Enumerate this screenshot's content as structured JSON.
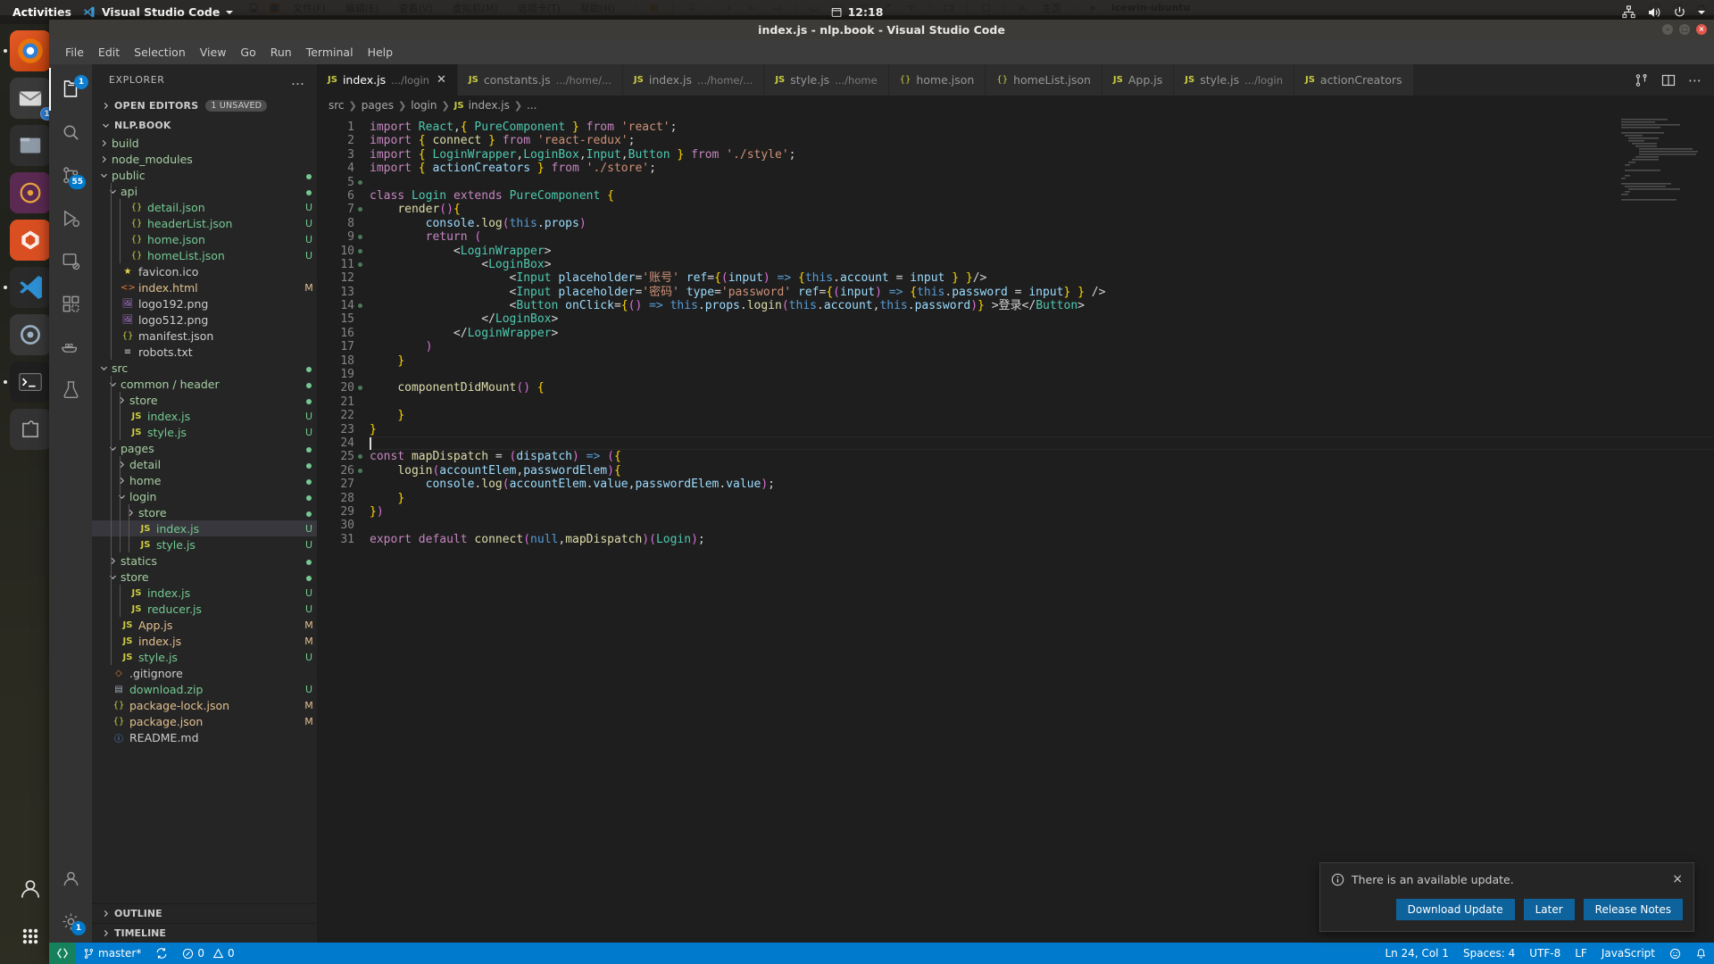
{
  "host": {
    "gnome": {
      "activities": "Activities",
      "app_name": "Visual Studio Code",
      "clock": "12:18",
      "app_icon": "vscode-icon",
      "network_icon": "network-icon",
      "volume_icon": "volume-icon",
      "power_icon": "power-icon"
    },
    "virtualbox": {
      "menus": [
        "文件(F)",
        "编辑(E)",
        "查看(V)",
        "虚拟机(M)",
        "选项卡(T)",
        "帮助(H)"
      ],
      "vm_name": "icewin-ubuntu",
      "indicator": "主页"
    }
  },
  "window": {
    "title": "index.js - nlp.book - Visual Studio Code",
    "minimize": "–",
    "maximize": "□",
    "close": "×"
  },
  "menubar": [
    "File",
    "Edit",
    "Selection",
    "View",
    "Go",
    "Run",
    "Terminal",
    "Help"
  ],
  "activitybar": {
    "items": [
      {
        "name": "explorer-icon",
        "badge": ""
      },
      {
        "name": "search-icon",
        "badge": ""
      },
      {
        "name": "source-control-icon",
        "badge": "55"
      },
      {
        "name": "run-debug-icon",
        "badge": ""
      },
      {
        "name": "remote-explorer-icon",
        "badge": ""
      },
      {
        "name": "extensions-icon",
        "badge": ""
      },
      {
        "name": "docker-icon",
        "badge": ""
      },
      {
        "name": "test-icon",
        "badge": ""
      }
    ],
    "bottom": [
      {
        "name": "accounts-icon",
        "badge": ""
      },
      {
        "name": "settings-gear-icon",
        "badge": "1"
      }
    ]
  },
  "sidebar": {
    "title": "EXPLORER",
    "more_actions": "…",
    "open_editors": {
      "label": "OPEN EDITORS",
      "badge": "1 UNSAVED",
      "expanded": false
    },
    "project": {
      "label": "NLP.BOOK",
      "expanded": true,
      "status": ""
    },
    "outline": "OUTLINE",
    "timeline": "TIMELINE",
    "tree": [
      {
        "label": "build",
        "depth": 1,
        "kind": "folder",
        "expanded": false,
        "status": ""
      },
      {
        "label": "node_modules",
        "depth": 1,
        "kind": "folder",
        "expanded": false,
        "status": ""
      },
      {
        "label": "public",
        "depth": 1,
        "kind": "folder",
        "expanded": true,
        "status": "dot"
      },
      {
        "label": "api",
        "depth": 2,
        "kind": "folder",
        "expanded": true,
        "status": "dot"
      },
      {
        "label": "detail.json",
        "depth": 3,
        "kind": "json",
        "status": "U"
      },
      {
        "label": "headerList.json",
        "depth": 3,
        "kind": "json",
        "status": "U"
      },
      {
        "label": "home.json",
        "depth": 3,
        "kind": "json",
        "status": "U"
      },
      {
        "label": "homeList.json",
        "depth": 3,
        "kind": "json",
        "status": "U"
      },
      {
        "label": "favicon.ico",
        "depth": 2,
        "kind": "star",
        "status": ""
      },
      {
        "label": "index.html",
        "depth": 2,
        "kind": "html",
        "status": "M"
      },
      {
        "label": "logo192.png",
        "depth": 2,
        "kind": "image",
        "status": ""
      },
      {
        "label": "logo512.png",
        "depth": 2,
        "kind": "image",
        "status": ""
      },
      {
        "label": "manifest.json",
        "depth": 2,
        "kind": "json",
        "status": ""
      },
      {
        "label": "robots.txt",
        "depth": 2,
        "kind": "txt",
        "status": ""
      },
      {
        "label": "src",
        "depth": 1,
        "kind": "folder",
        "expanded": true,
        "status": "dot"
      },
      {
        "label": "common / header",
        "depth": 2,
        "kind": "folder",
        "expanded": true,
        "status": "dot"
      },
      {
        "label": "store",
        "depth": 3,
        "kind": "folder",
        "expanded": false,
        "status": "dot"
      },
      {
        "label": "index.js",
        "depth": 3,
        "kind": "js",
        "status": "U"
      },
      {
        "label": "style.js",
        "depth": 3,
        "kind": "js",
        "status": "U"
      },
      {
        "label": "pages",
        "depth": 2,
        "kind": "folder",
        "expanded": true,
        "status": "dot"
      },
      {
        "label": "detail",
        "depth": 3,
        "kind": "folder",
        "expanded": false,
        "status": "dot"
      },
      {
        "label": "home",
        "depth": 3,
        "kind": "folder",
        "expanded": false,
        "status": "dot"
      },
      {
        "label": "login",
        "depth": 3,
        "kind": "folder",
        "expanded": true,
        "status": "dot"
      },
      {
        "label": "store",
        "depth": 4,
        "kind": "folder",
        "expanded": false,
        "status": "dot"
      },
      {
        "label": "index.js",
        "depth": 4,
        "kind": "js",
        "status": "U",
        "selected": true
      },
      {
        "label": "style.js",
        "depth": 4,
        "kind": "js",
        "status": "U"
      },
      {
        "label": "statics",
        "depth": 2,
        "kind": "folder",
        "expanded": false,
        "status": "dot"
      },
      {
        "label": "store",
        "depth": 2,
        "kind": "folder",
        "expanded": true,
        "status": "dot"
      },
      {
        "label": "index.js",
        "depth": 3,
        "kind": "js",
        "status": "U"
      },
      {
        "label": "reducer.js",
        "depth": 3,
        "kind": "js",
        "status": "U"
      },
      {
        "label": "App.js",
        "depth": 2,
        "kind": "js",
        "status": "M"
      },
      {
        "label": "index.js",
        "depth": 2,
        "kind": "js",
        "status": "M"
      },
      {
        "label": "style.js",
        "depth": 2,
        "kind": "js",
        "status": "U"
      },
      {
        "label": ".gitignore",
        "depth": 1,
        "kind": "git",
        "status": ""
      },
      {
        "label": "download.zip",
        "depth": 1,
        "kind": "zip",
        "status": "U"
      },
      {
        "label": "package-lock.json",
        "depth": 1,
        "kind": "json",
        "status": "M"
      },
      {
        "label": "package.json",
        "depth": 1,
        "kind": "json",
        "status": "M"
      },
      {
        "label": "README.md",
        "depth": 1,
        "kind": "md",
        "status": ""
      }
    ]
  },
  "editor": {
    "tabs": [
      {
        "name": "index.js",
        "path": ".../login",
        "kind": "js",
        "active": true,
        "dirty": false
      },
      {
        "name": "constants.js",
        "path": ".../home/...",
        "kind": "js",
        "active": false
      },
      {
        "name": "index.js",
        "path": ".../home/...",
        "kind": "js",
        "active": false
      },
      {
        "name": "style.js",
        "path": ".../home",
        "kind": "js",
        "active": false
      },
      {
        "name": "home.json",
        "path": "",
        "kind": "json",
        "active": false
      },
      {
        "name": "homeList.json",
        "path": "",
        "kind": "json",
        "active": false
      },
      {
        "name": "App.js",
        "path": "",
        "kind": "js",
        "active": false
      },
      {
        "name": "style.js",
        "path": ".../login",
        "kind": "js",
        "active": false
      },
      {
        "name": "actionCreators",
        "path": "",
        "kind": "js",
        "active": false
      }
    ],
    "tab_actions": [
      {
        "name": "split-editor-down-icon",
        "label": "⑂"
      },
      {
        "name": "split-editor-icon",
        "label": "▥"
      },
      {
        "name": "more-actions-icon",
        "label": "…"
      }
    ],
    "breadcrumb": [
      "src",
      "pages",
      "login",
      "index.js",
      "..."
    ],
    "breadcrumb_file_icon": "JS",
    "line_numbers": [
      1,
      2,
      3,
      4,
      5,
      6,
      7,
      8,
      9,
      10,
      11,
      12,
      13,
      14,
      15,
      16,
      17,
      18,
      19,
      20,
      21,
      22,
      23,
      24,
      25,
      26,
      27,
      28,
      29,
      30,
      31
    ],
    "lines": [
      "import React,{ PureComponent } from 'react';",
      "import { connect } from 'react-redux';",
      "import { LoginWrapper,LoginBox,Input,Button } from './style';",
      "import { actionCreators } from './store';",
      "",
      "class Login extends PureComponent {",
      "    render(){",
      "        console.log(this.props)",
      "        return (",
      "            <LoginWrapper>",
      "                <LoginBox>",
      "                    <Input placeholder='账号' ref={(input) => {this.account = input } }/>",
      "                    <Input placeholder='密码' type='password' ref={(input) => {this.password = input} } />",
      "                    <Button onClick={() => this.props.login(this.account,this.password)} >登录</Button>",
      "                </LoginBox>",
      "            </LoginWrapper>",
      "        )",
      "    }",
      "",
      "    componentDidMount() {",
      "",
      "    }",
      "}",
      "",
      "const mapDispatch = (dispatch) => ({",
      "    login(accountElem,passwordElem){",
      "        console.log(accountElem.value,passwordElem.value);",
      "    }",
      "})",
      "",
      "export default connect(null,mapDispatch)(Login);"
    ]
  },
  "notification": {
    "icon": "info-icon",
    "message": "There is an available update.",
    "close": "×",
    "primary_button": "Download Update",
    "secondary_button": "Later",
    "tertiary_button": "Release Notes"
  },
  "statusbar": {
    "remote_icon": "remote-indicator-icon",
    "branch_icon": "source-control-branch-icon",
    "branch": "master*",
    "sync_icon": "sync-icon",
    "errors_icon": "error-icon",
    "errors": "0",
    "warnings_icon": "warning-icon",
    "warnings": "0",
    "cursor_position": "Ln 24, Col 1",
    "indentation": "Spaces: 4",
    "encoding": "UTF-8",
    "eol": "LF",
    "language": "JavaScript",
    "feedback_icon": "smiley-icon",
    "bell_icon": "bell-icon"
  },
  "colors": {
    "accent": "#007acc",
    "remote_green": "#16825d",
    "modified": "#e2c08d",
    "untracked": "#73c991",
    "tab_active_bg": "#1e1e1e",
    "sidebar_bg": "#252526",
    "editor_bg": "#1e1e1e"
  }
}
